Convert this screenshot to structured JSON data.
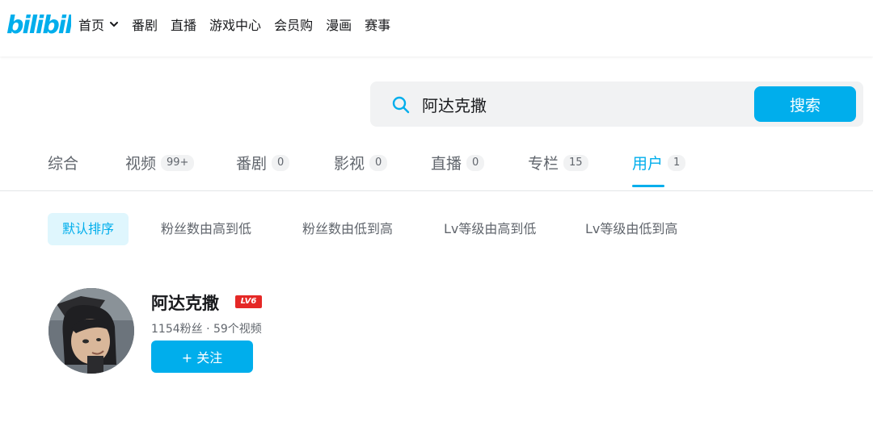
{
  "brand": {
    "logo_text": "bilibili",
    "color": "#00aeec"
  },
  "nav": {
    "items": [
      {
        "label": "首页",
        "icon": "chevron-down-icon"
      },
      {
        "label": "番剧"
      },
      {
        "label": "直播"
      },
      {
        "label": "游戏中心"
      },
      {
        "label": "会员购"
      },
      {
        "label": "漫画"
      },
      {
        "label": "赛事"
      }
    ]
  },
  "search": {
    "value": "阿达克撒",
    "button_label": "搜索",
    "icon": "search-icon"
  },
  "tabs": [
    {
      "label": "综合",
      "badge": ""
    },
    {
      "label": "视频",
      "badge": "99+"
    },
    {
      "label": "番剧",
      "badge": "0"
    },
    {
      "label": "影视",
      "badge": "0"
    },
    {
      "label": "直播",
      "badge": "0"
    },
    {
      "label": "专栏",
      "badge": "15"
    },
    {
      "label": "用户",
      "badge": "1",
      "active": true
    }
  ],
  "sorts": [
    {
      "label": "默认排序",
      "active": true
    },
    {
      "label": "粉丝数由高到低"
    },
    {
      "label": "粉丝数由低到高"
    },
    {
      "label": "Lv等级由高到低"
    },
    {
      "label": "Lv等级由低到高"
    }
  ],
  "user": {
    "name": "阿达克撒",
    "level": "LV6",
    "meta": "1154粉丝 · 59个视频",
    "follow_label": "+ 关注"
  },
  "colors": {
    "accent": "#00aeec",
    "level_badge": "#e52826",
    "muted_text": "#61666d"
  }
}
